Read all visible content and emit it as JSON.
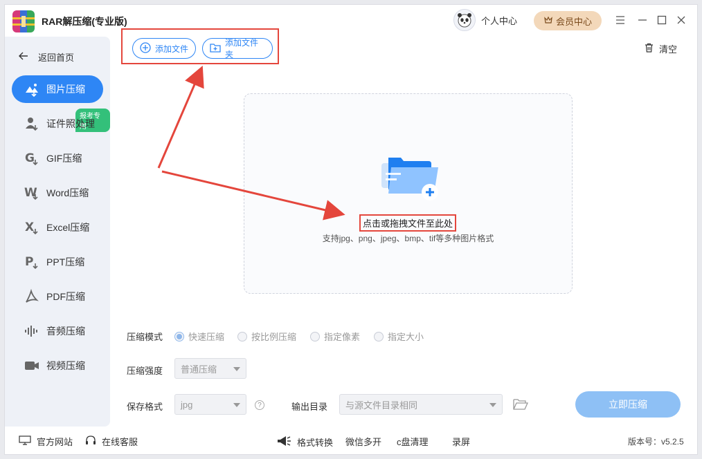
{
  "app": {
    "title": "RAR解压缩(专业版)",
    "profile_label": "个人中心",
    "vip_label": "会员中心"
  },
  "toolbar": {
    "add_file": "添加文件",
    "add_folder": "添加文件夹",
    "clear": "清空"
  },
  "sidebar": {
    "back": "返回首页",
    "badge": "报考专用",
    "items": [
      {
        "label": "图片压缩",
        "icon": "image-compress-icon",
        "active": true
      },
      {
        "label": "证件照处理",
        "icon": "id-photo-icon"
      },
      {
        "label": "GIF压缩",
        "icon": "gif-icon"
      },
      {
        "label": "Word压缩",
        "icon": "word-icon"
      },
      {
        "label": "Excel压缩",
        "icon": "excel-icon"
      },
      {
        "label": "PPT压缩",
        "icon": "ppt-icon"
      },
      {
        "label": "PDF压缩",
        "icon": "pdf-icon"
      },
      {
        "label": "音频压缩",
        "icon": "audio-icon"
      },
      {
        "label": "视频压缩",
        "icon": "video-icon"
      }
    ]
  },
  "dropzone": {
    "main_text": "点击或拖拽文件至此处",
    "sub_text": "支持jpg、png、jpeg、bmp、tif等多种图片格式"
  },
  "options": {
    "mode_label": "压缩模式",
    "modes": [
      "快速压缩",
      "按比例压缩",
      "指定像素",
      "指定大小"
    ],
    "selected_mode": "快速压缩",
    "strength_label": "压缩强度",
    "strength_value": "普通压缩",
    "format_label": "保存格式",
    "format_value": "jpg",
    "output_label": "输出目录",
    "output_value": "与源文件目录相同",
    "compress_button": "立即压缩"
  },
  "footer": {
    "website": "官方网站",
    "support": "在线客服",
    "format_convert": "格式转换",
    "wechat": "微信多开",
    "disk_clean": "c盘清理",
    "record": "录屏",
    "version": "版本号：v5.2.5"
  },
  "colors": {
    "accent": "#2e86f5",
    "annotation": "#e4463c",
    "vip": "#f3d8ba",
    "badge": "#33c07a"
  }
}
